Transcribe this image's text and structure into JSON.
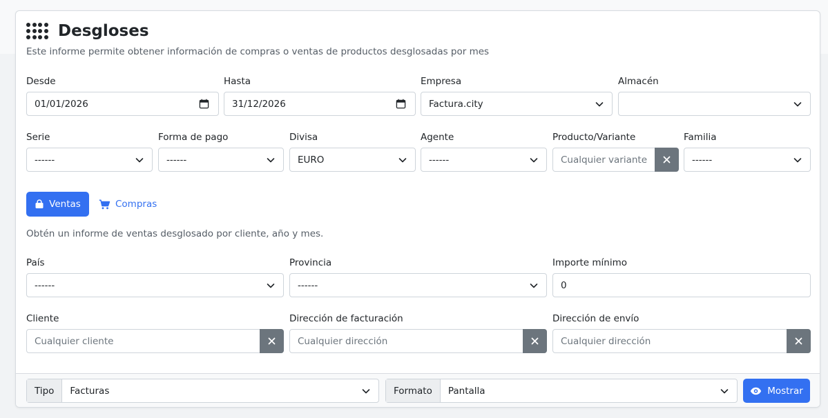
{
  "header": {
    "title": "Desgloses",
    "subtitle": "Este informe permite obtener información de compras o ventas de productos desglosadas por mes"
  },
  "filters": {
    "desde": {
      "label": "Desde",
      "value": "01/01/2026"
    },
    "hasta": {
      "label": "Hasta",
      "value": "31/12/2026"
    },
    "empresa": {
      "label": "Empresa",
      "value": "Factura.city"
    },
    "almacen": {
      "label": "Almacén",
      "value": ""
    },
    "serie": {
      "label": "Serie",
      "value": "------"
    },
    "forma_pago": {
      "label": "Forma de pago",
      "value": "------"
    },
    "divisa": {
      "label": "Divisa",
      "value": "EURO"
    },
    "agente": {
      "label": "Agente",
      "value": "------"
    },
    "producto": {
      "label": "Producto/Variante",
      "placeholder": "Cualquier variante"
    },
    "familia": {
      "label": "Familia",
      "value": "------"
    }
  },
  "mode": {
    "ventas_label": "Ventas",
    "compras_label": "Compras",
    "description": "Obtén un informe de ventas desglosado por cliente, año y mes."
  },
  "sales_filters": {
    "pais": {
      "label": "País",
      "value": "------"
    },
    "provincia": {
      "label": "Provincia",
      "value": "------"
    },
    "importe_minimo": {
      "label": "Importe mínimo",
      "value": "0"
    },
    "cliente": {
      "label": "Cliente",
      "placeholder": "Cualquier cliente"
    },
    "dir_facturacion": {
      "label": "Dirección de facturación",
      "placeholder": "Cualquier dirección"
    },
    "dir_envio": {
      "label": "Dirección de envío",
      "placeholder": "Cualquier dirección"
    }
  },
  "footer": {
    "tipo_label": "Tipo",
    "tipo_value": "Facturas",
    "formato_label": "Formato",
    "formato_value": "Pantalla",
    "mostrar_label": "Mostrar"
  },
  "colors": {
    "primary": "#3370f1",
    "secondary": "#6c757d",
    "border": "#ced4da"
  },
  "icons": {
    "header": "grid-dots-icon",
    "date": "calendar-icon",
    "select": "chevron-down-icon",
    "clear": "close-icon",
    "ventas": "shopping-bag-icon",
    "compras": "cart-icon",
    "mostrar": "eye-icon"
  }
}
